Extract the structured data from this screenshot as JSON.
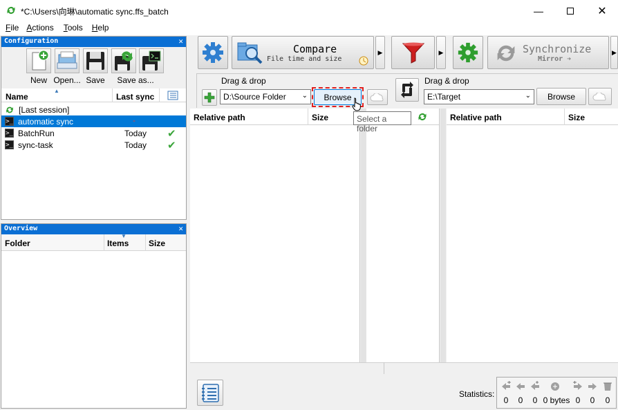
{
  "window": {
    "title": "*C:\\Users\\向琳\\automatic sync.ffs_batch"
  },
  "menu": [
    {
      "label": "File",
      "key": "F",
      "rest": "ile"
    },
    {
      "label": "Actions",
      "key": "A",
      "rest": "ctions"
    },
    {
      "label": "Tools",
      "key": "T",
      "rest": "ools"
    },
    {
      "label": "Help",
      "key": "H",
      "rest": "elp"
    }
  ],
  "configuration": {
    "title": "Configuration",
    "buttons": [
      "New",
      "Open...",
      "Save",
      "Save as..."
    ],
    "columns": {
      "name": "Name",
      "last_sync": "Last sync"
    },
    "items": [
      {
        "name": "[Last session]",
        "last_sync": "",
        "icon": "sync-icon",
        "selected": false,
        "check": false
      },
      {
        "name": "automatic sync",
        "last_sync": "-",
        "icon": "terminal-icon",
        "selected": true,
        "check": false
      },
      {
        "name": "BatchRun",
        "last_sync": "Today",
        "icon": "terminal-icon",
        "selected": false,
        "check": true
      },
      {
        "name": "sync-task",
        "last_sync": "Today",
        "icon": "terminal-icon",
        "selected": false,
        "check": true
      }
    ]
  },
  "overview": {
    "title": "Overview",
    "columns": {
      "folder": "Folder",
      "items": "Items",
      "size": "Size"
    }
  },
  "toolbar": {
    "compare_label": "Compare",
    "compare_sub": "File time and size",
    "sync_label": "Synchronize",
    "sync_sub": "Mirror ➔"
  },
  "left_folder": {
    "drag_label": "Drag & drop",
    "path": "D:\\Source Folder",
    "browse": "Browse",
    "tooltip": "Select a folder"
  },
  "right_folder": {
    "drag_label": "Drag & drop",
    "path": "E:\\Target",
    "browse": "Browse"
  },
  "grid": {
    "left": {
      "relative_path": "Relative path",
      "size": "Size"
    },
    "right": {
      "relative_path": "Relative path",
      "size": "Size"
    }
  },
  "statistics": {
    "label": "Statistics:",
    "values": [
      "0",
      "0",
      "0",
      "0 bytes",
      "0",
      "0",
      "0"
    ]
  },
  "colors": {
    "accent": "#0078d7",
    "panel_head": "#0a6fd4",
    "filter": "#cc1f1f",
    "gear": "#2f9e2f"
  }
}
